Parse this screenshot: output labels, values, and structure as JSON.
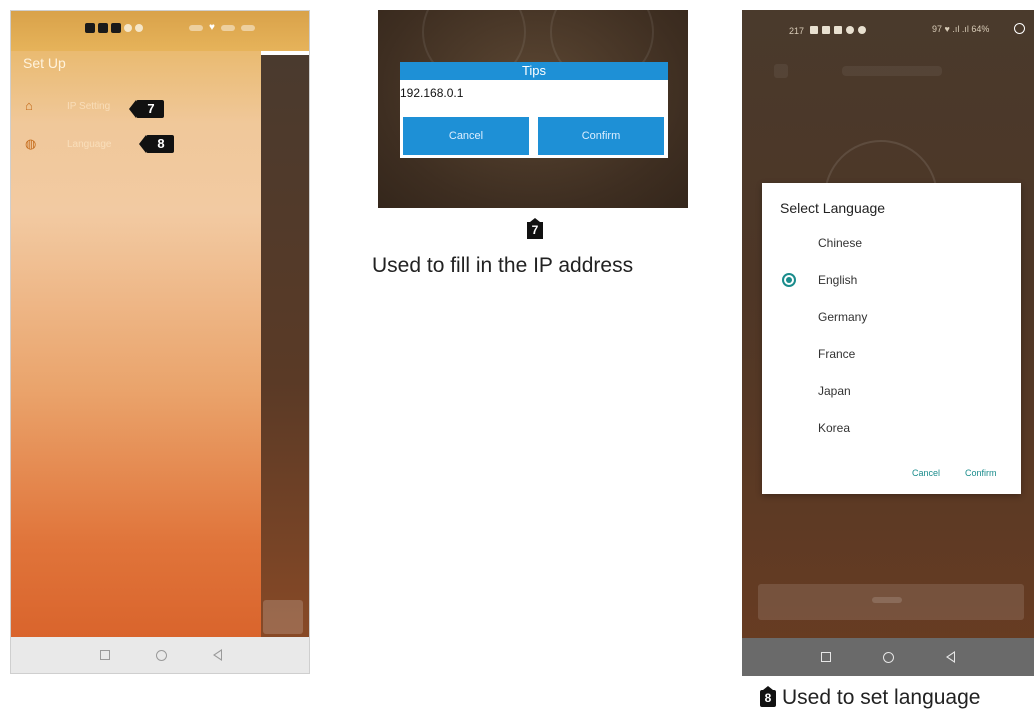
{
  "left_phone": {
    "title": "Set Up",
    "menu": [
      {
        "label": "IP Setting",
        "icon": "bookmark-icon",
        "tag": "7"
      },
      {
        "label": "Language",
        "icon": "globe-icon",
        "tag": "8"
      }
    ]
  },
  "tips_dialog": {
    "title": "Tips",
    "input_value": "192.168.0.1",
    "cancel_label": "Cancel",
    "confirm_label": "Confirm"
  },
  "middle_annotation": {
    "tag": "7",
    "caption": "Used to fill in the IP address"
  },
  "right_phone": {
    "status_time": "217",
    "status_right": "97 ♥ .ıl .ıl 64%",
    "dialog": {
      "title": "Select Language",
      "options": [
        "Chinese",
        "English",
        "Germany",
        "France",
        "Japan",
        "Korea"
      ],
      "selected": "English",
      "cancel_label": "Cancel",
      "confirm_label": "Confirm"
    }
  },
  "right_annotation": {
    "tag": "8",
    "caption": "Used to set language"
  },
  "colors": {
    "accent_blue": "#1e90d6",
    "accent_teal": "#1a8c8c",
    "drawer_top": "#e6b35a",
    "drawer_bottom": "#d9642c"
  }
}
